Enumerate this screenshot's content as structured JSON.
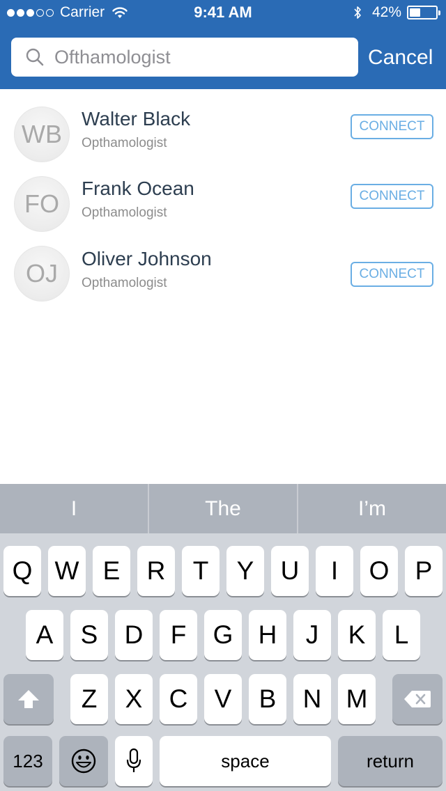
{
  "status_bar": {
    "carrier": "Carrier",
    "time": "9:41 AM",
    "battery_percent": "42%",
    "battery_level": 0.42,
    "signal_strength": 3,
    "signal_max": 5
  },
  "search": {
    "placeholder": "Ofthamologist",
    "value": "",
    "cancel_label": "Cancel"
  },
  "results": [
    {
      "initials": "WB",
      "name": "Walter Black",
      "role": "Opthamologist",
      "action": "CONNECT"
    },
    {
      "initials": "FO",
      "name": "Frank Ocean",
      "role": "Opthamologist",
      "action": "CONNECT"
    },
    {
      "initials": "OJ",
      "name": "Oliver Johnson",
      "role": "Opthamologist",
      "action": "CONNECT"
    }
  ],
  "keyboard": {
    "suggestions": [
      "I",
      "The",
      "I’m"
    ],
    "row1": [
      "Q",
      "W",
      "E",
      "R",
      "T",
      "Y",
      "U",
      "I",
      "O",
      "P"
    ],
    "row2": [
      "A",
      "S",
      "D",
      "F",
      "G",
      "H",
      "J",
      "K",
      "L"
    ],
    "row3": [
      "Z",
      "X",
      "C",
      "V",
      "B",
      "N",
      "M"
    ],
    "numbers_label": "123",
    "space_label": "space",
    "return_label": "return"
  },
  "colors": {
    "header_bg": "#2a6bb5",
    "accent": "#6aaee4",
    "name_text": "#2d3e50"
  }
}
